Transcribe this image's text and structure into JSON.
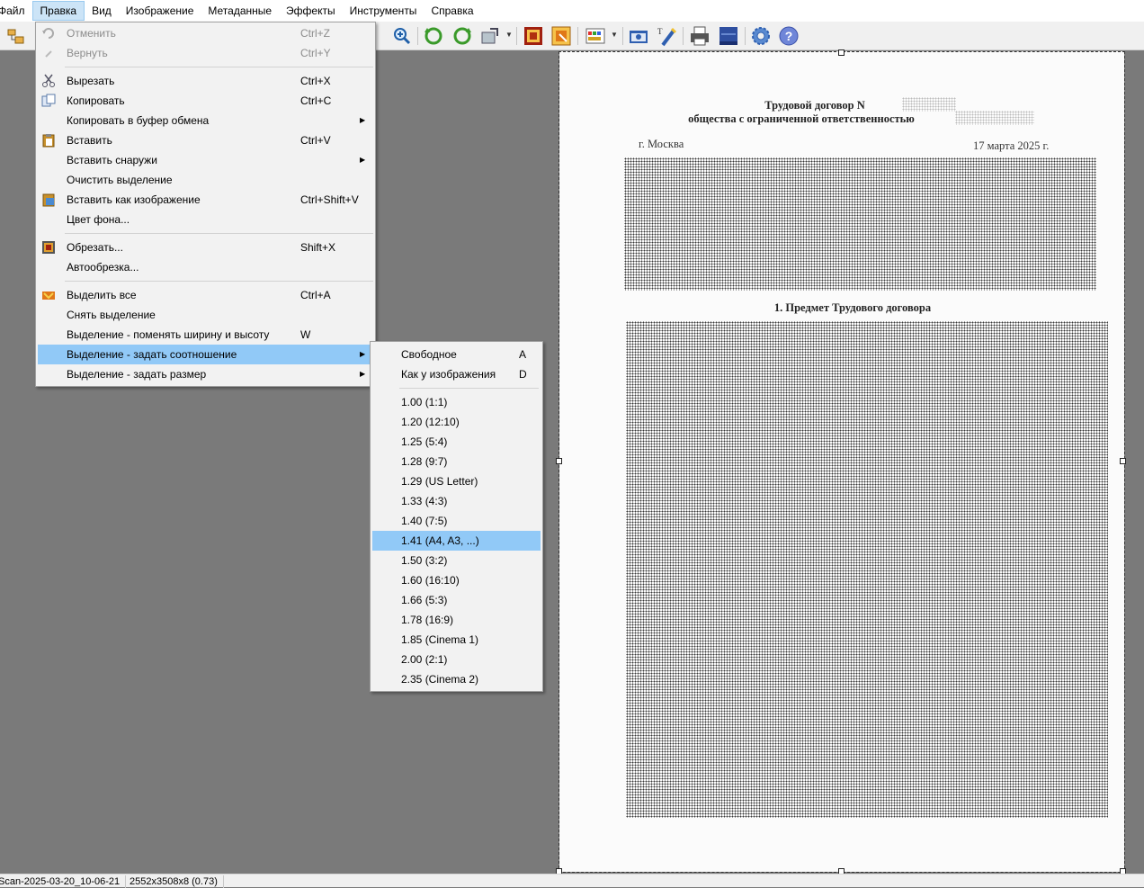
{
  "menubar": {
    "items": [
      "Файл",
      "Правка",
      "Вид",
      "Изображение",
      "Метаданные",
      "Эффекты",
      "Инструменты",
      "Справка"
    ],
    "active": "Правка"
  },
  "toolbar": {
    "icons": [
      "open-folder-icon",
      "zoom-in-icon",
      "rotate-left-icon",
      "rotate-right-icon",
      "resize-icon",
      "crop-icon",
      "auto-crop-icon",
      "color-palette-icon",
      "capture-icon",
      "paint-icon",
      "print-icon",
      "scan-icon",
      "settings-icon",
      "help-icon"
    ]
  },
  "edit_menu": {
    "items": [
      {
        "label": "Отменить",
        "shortcut": "Ctrl+Z",
        "disabled": true,
        "icon": "undo-icon"
      },
      {
        "label": "Вернуть",
        "shortcut": "Ctrl+Y",
        "disabled": true,
        "icon": "redo-icon"
      },
      {
        "label": "Вырезать",
        "shortcut": "Ctrl+X",
        "icon": "scissors-icon"
      },
      {
        "label": "Копировать",
        "shortcut": "Ctrl+C",
        "icon": "copy-icon"
      },
      {
        "label": "Копировать в буфер обмена",
        "submenu": true
      },
      {
        "label": "Вставить",
        "shortcut": "Ctrl+V",
        "icon": "paste-icon"
      },
      {
        "label": "Вставить снаружи",
        "submenu": true
      },
      {
        "label": "Очистить выделение"
      },
      {
        "label": "Вставить как изображение",
        "shortcut": "Ctrl+Shift+V",
        "icon": "paste-image-icon"
      },
      {
        "label": "Цвет фона..."
      },
      {
        "label": "Обрезать...",
        "shortcut": "Shift+X",
        "icon": "crop-icon"
      },
      {
        "label": "Автообрезка..."
      },
      {
        "label": "Выделить все",
        "shortcut": "Ctrl+A",
        "icon": "select-all-icon"
      },
      {
        "label": "Снять выделение"
      },
      {
        "label": "Выделение - поменять ширину и высоту",
        "shortcut": "W"
      },
      {
        "label": "Выделение - задать соотношение",
        "submenu": true,
        "highlighted": true
      },
      {
        "label": "Выделение - задать размер",
        "submenu": true
      }
    ]
  },
  "ratio_submenu": {
    "items": [
      {
        "label": "Свободное",
        "shortcut": "A"
      },
      {
        "label": "Как у изображения",
        "shortcut": "D"
      },
      {
        "label": "1.00 (1:1)"
      },
      {
        "label": "1.20 (12:10)"
      },
      {
        "label": "1.25 (5:4)"
      },
      {
        "label": "1.28 (9:7)"
      },
      {
        "label": "1.29 (US Letter)"
      },
      {
        "label": "1.33 (4:3)"
      },
      {
        "label": "1.40 (7:5)"
      },
      {
        "label": "1.41 (A4, A3, ...)",
        "highlighted": true
      },
      {
        "label": "1.50 (3:2)"
      },
      {
        "label": "1.60 (16:10)"
      },
      {
        "label": "1.66 (5:3)"
      },
      {
        "label": "1.78 (16:9)"
      },
      {
        "label": "1.85 (Cinema 1)"
      },
      {
        "label": "2.00 (2:1)"
      },
      {
        "label": "2.35 (Cinema 2)"
      }
    ]
  },
  "document": {
    "title_line1": "Трудовой договор N",
    "title_line2": "общества с ограниченной ответственностью",
    "city": "г. Москва",
    "date": "17 марта 2025 г.",
    "section1": "1. Предмет Трудового договора"
  },
  "statusbar": {
    "filename": "Scan-2025-03-20_10-06-21",
    "dimensions": "2552x3508x8 (0.73)"
  }
}
